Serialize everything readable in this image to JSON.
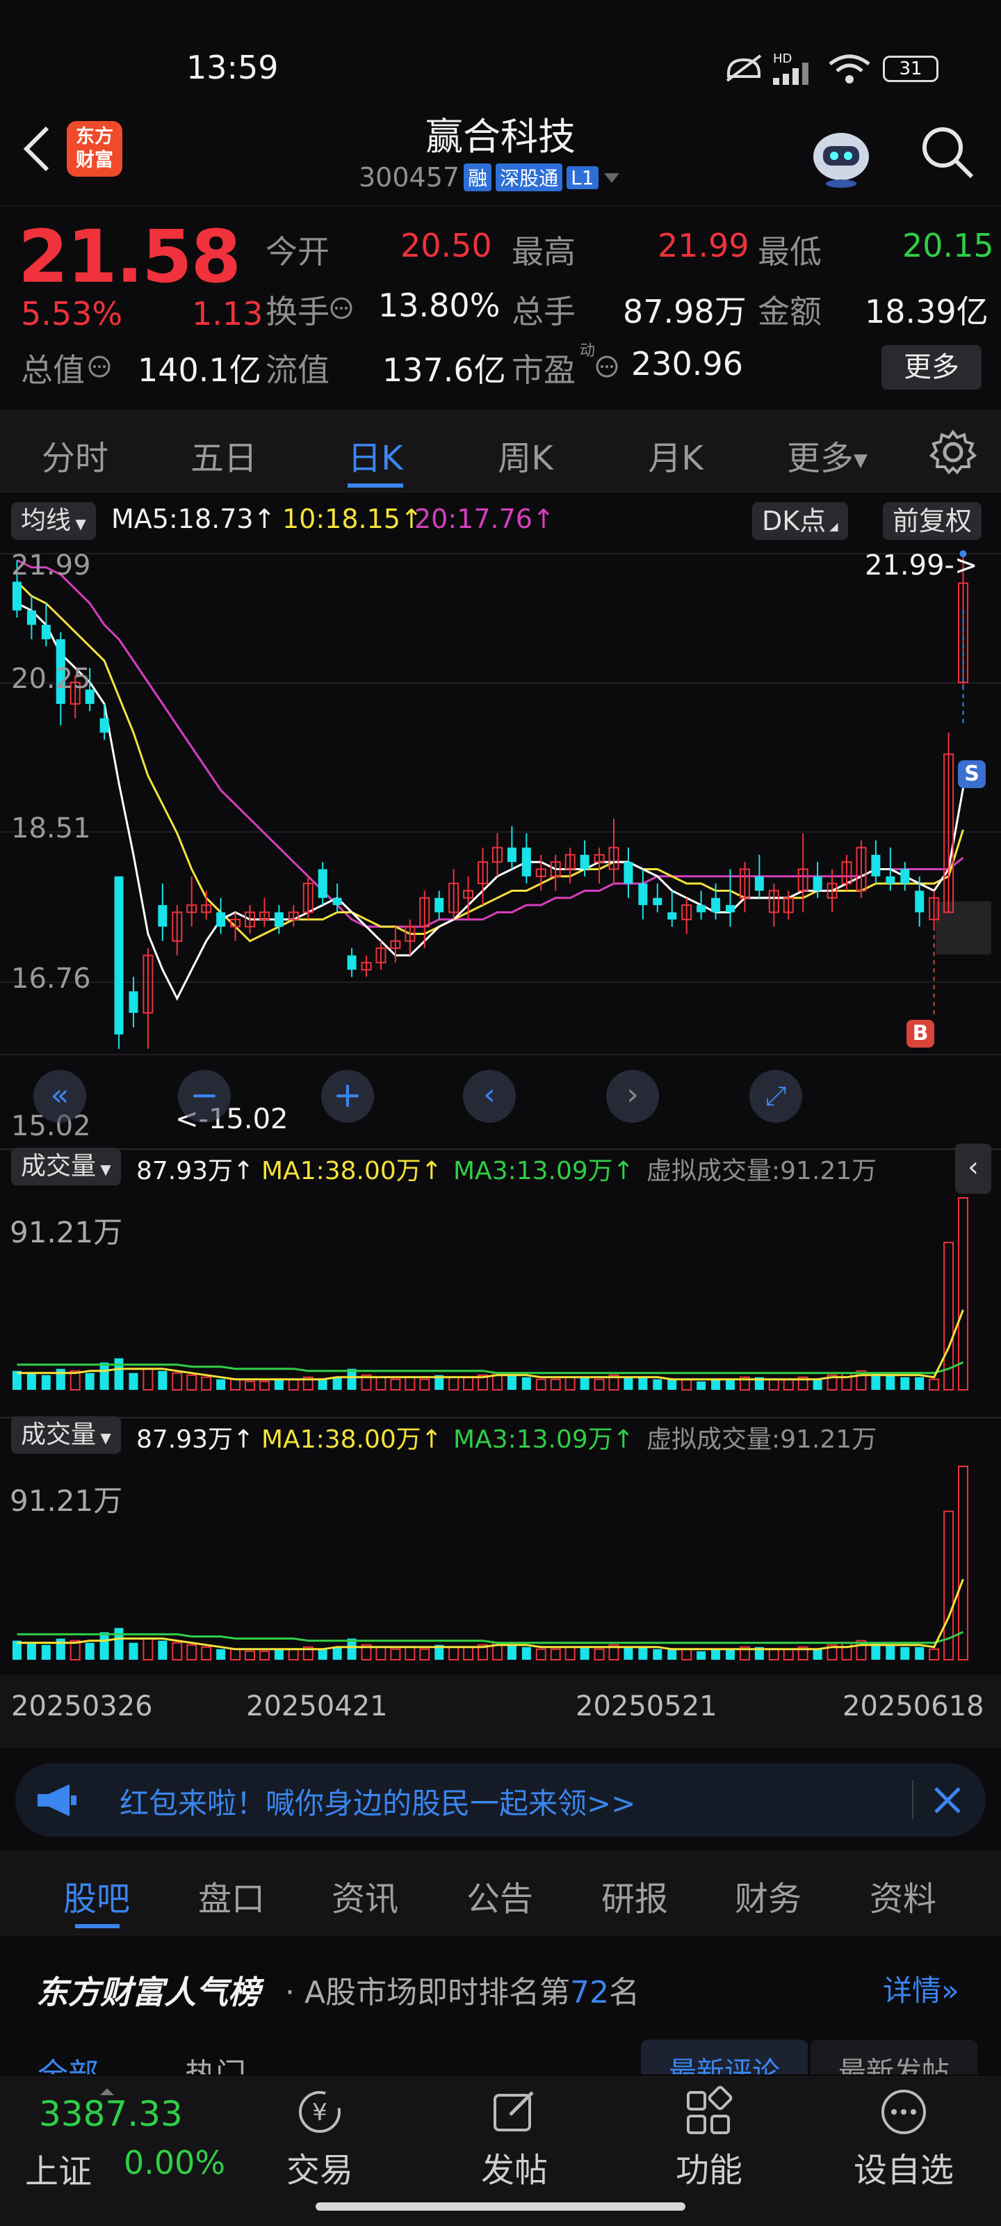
{
  "status": {
    "time": "13:59",
    "battery": "31",
    "net": "HD"
  },
  "header": {
    "logo_line1": "东方",
    "logo_line2": "财富",
    "stock_name": "赢合科技",
    "code": "300457",
    "badge1": "融",
    "badge2": "深股通",
    "badge3": "L1"
  },
  "quote": {
    "price": "21.58",
    "pct": "5.53%",
    "change": "1.13",
    "open_label": "今开",
    "open": "20.50",
    "high_label": "最高",
    "high": "21.99",
    "low_label": "最低",
    "low": "20.15",
    "turnover_label": "换手",
    "turnover": "13.80%",
    "volume_label": "总手",
    "volume": "87.98万",
    "amount_label": "金额",
    "amount": "18.39亿",
    "mktcap_label": "总值",
    "mktcap": "140.1亿",
    "float_label": "流值",
    "float": "137.6亿",
    "pe_label": "市盈",
    "pe_sup": "动",
    "pe": "230.96",
    "more": "更多"
  },
  "tabs": [
    "分时",
    "五日",
    "日K",
    "周K",
    "月K",
    "更多"
  ],
  "active_tab": "日K",
  "kline": {
    "ma_label": "均线",
    "ma5": "MA5:18.73",
    "ma10": "10:18.15",
    "ma20": "20:17.76",
    "dk": "DK点",
    "fq": "前复权",
    "y_labels": [
      "21.99",
      "20.25",
      "18.51",
      "16.76",
      "15.02"
    ],
    "high_marker": "21.99->",
    "low_marker": "<-15.02",
    "sell_marker": "S",
    "buy_marker": "B"
  },
  "volume_panel": {
    "label": "成交量",
    "vol": "87.93万",
    "ma1": "MA1:38.00万",
    "ma3": "MA3:13.09万",
    "virtual": "虚拟成交量:91.21万",
    "max": "91.21万"
  },
  "dates": [
    "20250326",
    "20250421",
    "20250521",
    "20250618"
  ],
  "colors": {
    "up": "#f0323c",
    "down": "#17e3e8",
    "ma5": "#ffffff",
    "ma10": "#f5e23a",
    "ma20": "#d53fbd",
    "accent": "#3b86f0"
  },
  "chart_data": {
    "type": "candlestick",
    "ylim": [
      15.02,
      21.99
    ],
    "candles": [
      {
        "o": 21.6,
        "h": 21.9,
        "l": 21.1,
        "c": 21.2
      },
      {
        "o": 21.2,
        "h": 21.4,
        "l": 20.8,
        "c": 21.0
      },
      {
        "o": 21.0,
        "h": 21.3,
        "l": 20.7,
        "c": 20.8
      },
      {
        "o": 20.8,
        "h": 20.9,
        "l": 19.6,
        "c": 19.9
      },
      {
        "o": 19.9,
        "h": 20.3,
        "l": 19.7,
        "c": 20.2
      },
      {
        "o": 20.1,
        "h": 20.4,
        "l": 19.8,
        "c": 19.9
      },
      {
        "o": 19.7,
        "h": 19.9,
        "l": 19.4,
        "c": 19.5
      },
      {
        "o": 17.5,
        "h": 17.5,
        "l": 15.1,
        "c": 15.3
      },
      {
        "o": 15.9,
        "h": 16.1,
        "l": 15.4,
        "c": 15.6
      },
      {
        "o": 15.6,
        "h": 16.5,
        "l": 15.1,
        "c": 16.4
      },
      {
        "o": 17.1,
        "h": 17.4,
        "l": 16.6,
        "c": 16.8
      },
      {
        "o": 16.6,
        "h": 17.1,
        "l": 16.4,
        "c": 17.0
      },
      {
        "o": 17.0,
        "h": 17.5,
        "l": 16.8,
        "c": 17.1
      },
      {
        "o": 17.0,
        "h": 17.3,
        "l": 16.9,
        "c": 17.1
      },
      {
        "o": 17.0,
        "h": 17.2,
        "l": 16.7,
        "c": 16.8
      },
      {
        "o": 16.8,
        "h": 17.0,
        "l": 16.6,
        "c": 16.9
      },
      {
        "o": 16.8,
        "h": 17.1,
        "l": 16.7,
        "c": 17.0
      },
      {
        "o": 16.9,
        "h": 17.2,
        "l": 16.8,
        "c": 17.0
      },
      {
        "o": 17.0,
        "h": 17.1,
        "l": 16.7,
        "c": 16.8
      },
      {
        "o": 16.9,
        "h": 17.1,
        "l": 16.8,
        "c": 17.0
      },
      {
        "o": 17.0,
        "h": 17.5,
        "l": 16.9,
        "c": 17.4
      },
      {
        "o": 17.6,
        "h": 17.7,
        "l": 17.1,
        "c": 17.2
      },
      {
        "o": 17.2,
        "h": 17.4,
        "l": 17.0,
        "c": 17.1
      },
      {
        "o": 16.4,
        "h": 16.5,
        "l": 16.1,
        "c": 16.2
      },
      {
        "o": 16.2,
        "h": 16.4,
        "l": 16.1,
        "c": 16.3
      },
      {
        "o": 16.3,
        "h": 16.6,
        "l": 16.2,
        "c": 16.5
      },
      {
        "o": 16.5,
        "h": 16.8,
        "l": 16.3,
        "c": 16.6
      },
      {
        "o": 16.6,
        "h": 16.9,
        "l": 16.4,
        "c": 16.8
      },
      {
        "o": 16.8,
        "h": 17.3,
        "l": 16.5,
        "c": 17.2
      },
      {
        "o": 17.2,
        "h": 17.3,
        "l": 16.9,
        "c": 17.0
      },
      {
        "o": 17.0,
        "h": 17.6,
        "l": 16.9,
        "c": 17.4
      },
      {
        "o": 17.2,
        "h": 17.5,
        "l": 16.9,
        "c": 17.3
      },
      {
        "o": 17.4,
        "h": 17.9,
        "l": 17.1,
        "c": 17.7
      },
      {
        "o": 17.7,
        "h": 18.1,
        "l": 17.5,
        "c": 17.9
      },
      {
        "o": 17.9,
        "h": 18.2,
        "l": 17.6,
        "c": 17.7
      },
      {
        "o": 17.9,
        "h": 18.1,
        "l": 17.4,
        "c": 17.5
      },
      {
        "o": 17.5,
        "h": 17.8,
        "l": 17.3,
        "c": 17.6
      },
      {
        "o": 17.5,
        "h": 17.8,
        "l": 17.3,
        "c": 17.7
      },
      {
        "o": 17.6,
        "h": 17.9,
        "l": 17.4,
        "c": 17.8
      },
      {
        "o": 17.8,
        "h": 18.0,
        "l": 17.5,
        "c": 17.6
      },
      {
        "o": 17.7,
        "h": 17.9,
        "l": 17.4,
        "c": 17.8
      },
      {
        "o": 17.6,
        "h": 18.3,
        "l": 17.4,
        "c": 17.9
      },
      {
        "o": 17.7,
        "h": 17.9,
        "l": 17.2,
        "c": 17.4
      },
      {
        "o": 17.4,
        "h": 17.6,
        "l": 16.9,
        "c": 17.1
      },
      {
        "o": 17.2,
        "h": 17.4,
        "l": 17.0,
        "c": 17.1
      },
      {
        "o": 17.0,
        "h": 17.3,
        "l": 16.8,
        "c": 16.9
      },
      {
        "o": 16.9,
        "h": 17.2,
        "l": 16.7,
        "c": 17.1
      },
      {
        "o": 17.1,
        "h": 17.3,
        "l": 16.9,
        "c": 17.0
      },
      {
        "o": 17.2,
        "h": 17.4,
        "l": 16.9,
        "c": 17.0
      },
      {
        "o": 17.1,
        "h": 17.6,
        "l": 16.8,
        "c": 17.0
      },
      {
        "o": 17.2,
        "h": 17.7,
        "l": 17.0,
        "c": 17.6
      },
      {
        "o": 17.5,
        "h": 17.8,
        "l": 17.2,
        "c": 17.3
      },
      {
        "o": 17.0,
        "h": 17.4,
        "l": 16.8,
        "c": 17.3
      },
      {
        "o": 17.0,
        "h": 17.3,
        "l": 16.9,
        "c": 17.2
      },
      {
        "o": 17.3,
        "h": 18.1,
        "l": 17.0,
        "c": 17.6
      },
      {
        "o": 17.5,
        "h": 17.7,
        "l": 17.2,
        "c": 17.3
      },
      {
        "o": 17.2,
        "h": 17.6,
        "l": 17.0,
        "c": 17.4
      },
      {
        "o": 17.4,
        "h": 17.8,
        "l": 17.3,
        "c": 17.7
      },
      {
        "o": 17.3,
        "h": 18.0,
        "l": 17.2,
        "c": 17.9
      },
      {
        "o": 17.8,
        "h": 18.0,
        "l": 17.4,
        "c": 17.5
      },
      {
        "o": 17.5,
        "h": 17.9,
        "l": 17.3,
        "c": 17.4
      },
      {
        "o": 17.6,
        "h": 17.7,
        "l": 17.3,
        "c": 17.4
      },
      {
        "o": 17.3,
        "h": 17.5,
        "l": 16.8,
        "c": 17.0
      },
      {
        "o": 16.9,
        "h": 17.3,
        "l": 16.8,
        "c": 17.2
      },
      {
        "o": 17.0,
        "h": 19.5,
        "l": 17.0,
        "c": 19.2
      },
      {
        "o": 20.2,
        "h": 21.99,
        "l": 20.15,
        "c": 21.58
      }
    ],
    "ma5": [
      21.3,
      21.2,
      21.0,
      20.6,
      20.4,
      20.2,
      19.9,
      18.8,
      17.8,
      16.7,
      16.2,
      15.8,
      16.2,
      16.6,
      16.9,
      17.0,
      16.9,
      16.9,
      16.9,
      16.9,
      17.0,
      17.1,
      17.2,
      17.0,
      16.8,
      16.6,
      16.4,
      16.4,
      16.6,
      16.8,
      16.9,
      17.1,
      17.3,
      17.5,
      17.6,
      17.7,
      17.7,
      17.6,
      17.6,
      17.6,
      17.7,
      17.7,
      17.7,
      17.6,
      17.5,
      17.3,
      17.2,
      17.1,
      17.0,
      17.0,
      17.2,
      17.2,
      17.2,
      17.2,
      17.3,
      17.3,
      17.3,
      17.4,
      17.5,
      17.6,
      17.6,
      17.5,
      17.4,
      17.3,
      17.6,
      18.73
    ],
    "ma10": [
      21.6,
      21.4,
      21.3,
      21.1,
      20.9,
      20.7,
      20.5,
      20.0,
      19.5,
      18.9,
      18.5,
      18.1,
      17.6,
      17.2,
      17.0,
      16.8,
      16.6,
      16.7,
      16.8,
      16.9,
      16.9,
      16.9,
      17.0,
      17.0,
      16.9,
      16.8,
      16.8,
      16.7,
      16.7,
      16.8,
      16.9,
      17.0,
      17.1,
      17.2,
      17.3,
      17.3,
      17.4,
      17.5,
      17.5,
      17.6,
      17.6,
      17.7,
      17.7,
      17.6,
      17.6,
      17.5,
      17.4,
      17.4,
      17.3,
      17.3,
      17.2,
      17.2,
      17.2,
      17.2,
      17.2,
      17.3,
      17.3,
      17.3,
      17.3,
      17.4,
      17.4,
      17.4,
      17.4,
      17.4,
      17.5,
      18.15
    ],
    "ma20": [
      21.9,
      21.8,
      21.8,
      21.7,
      21.5,
      21.3,
      21.0,
      20.8,
      20.5,
      20.2,
      19.9,
      19.6,
      19.3,
      19.0,
      18.7,
      18.5,
      18.3,
      18.1,
      17.9,
      17.7,
      17.5,
      17.3,
      17.1,
      16.9,
      16.8,
      16.8,
      16.8,
      16.8,
      16.8,
      16.9,
      16.9,
      16.9,
      16.9,
      17.0,
      17.0,
      17.1,
      17.1,
      17.2,
      17.2,
      17.3,
      17.3,
      17.4,
      17.4,
      17.4,
      17.5,
      17.5,
      17.5,
      17.5,
      17.5,
      17.5,
      17.5,
      17.5,
      17.5,
      17.5,
      17.5,
      17.5,
      17.5,
      17.5,
      17.5,
      17.6,
      17.6,
      17.6,
      17.6,
      17.6,
      17.6,
      17.76
    ],
    "volume_max": 91.21,
    "volume": [
      9,
      8,
      7,
      10,
      9,
      8,
      13,
      15,
      8,
      10,
      9,
      8,
      7,
      6,
      5,
      5,
      4,
      4,
      5,
      5,
      6,
      5,
      6,
      10,
      7,
      6,
      5,
      6,
      5,
      7,
      6,
      6,
      7,
      8,
      7,
      6,
      5,
      5,
      6,
      6,
      5,
      7,
      6,
      6,
      5,
      5,
      5,
      4,
      5,
      5,
      6,
      6,
      5,
      5,
      6,
      5,
      7,
      8,
      9,
      8,
      7,
      6,
      6,
      5,
      70,
      91.21
    ],
    "vol_ma1": [
      8,
      8,
      8,
      8,
      8,
      9,
      9,
      10,
      10,
      10,
      10,
      9,
      8,
      7,
      6,
      5,
      5,
      5,
      5,
      5,
      5,
      5,
      6,
      6,
      6,
      6,
      6,
      6,
      6,
      6,
      6,
      6,
      6,
      7,
      7,
      7,
      6,
      6,
      6,
      6,
      6,
      6,
      6,
      6,
      6,
      5,
      5,
      5,
      5,
      5,
      5,
      5,
      5,
      5,
      5,
      5,
      6,
      6,
      7,
      7,
      7,
      7,
      7,
      6,
      20,
      38
    ],
    "vol_ma3": [
      12,
      12,
      12,
      12,
      12,
      12,
      12,
      12,
      12,
      12,
      12,
      12,
      11,
      11,
      11,
      10,
      10,
      10,
      10,
      10,
      9,
      9,
      9,
      9,
      9,
      9,
      9,
      9,
      9,
      9,
      9,
      9,
      9,
      8,
      8,
      8,
      8,
      8,
      8,
      8,
      8,
      8,
      8,
      8,
      8,
      8,
      8,
      8,
      8,
      8,
      8,
      8,
      8,
      8,
      8,
      8,
      8,
      8,
      8,
      8,
      8,
      8,
      8,
      8,
      10,
      13.09
    ]
  },
  "banner": {
    "text": "红包来啦！喊你身边的股民一起来领>>"
  },
  "section_tabs": [
    "股吧",
    "盘口",
    "资讯",
    "公告",
    "研报",
    "财务",
    "资料"
  ],
  "rank": {
    "title": "东方财富人气榜",
    "text_pre": "· A股市场即时排名第",
    "rank": "72",
    "text_post": "名",
    "detail": "详情",
    "sub_tab1": "全部",
    "sub_tab2": "热门",
    "sort1": "最新评论",
    "sort2": "最新发帖"
  },
  "bottom": {
    "index_value": "3387.33",
    "index_name": "上证",
    "index_pct": "0.00%",
    "nav": [
      "交易",
      "发帖",
      "功能",
      "设自选"
    ]
  }
}
